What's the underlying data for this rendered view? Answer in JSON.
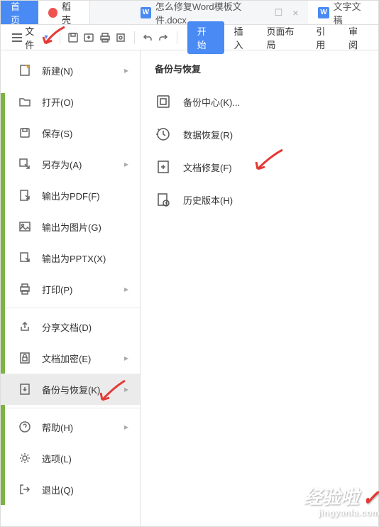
{
  "tabs": {
    "home": "首页",
    "docker": "稻壳",
    "doc1": "怎么修复Word模板文件.docx",
    "doc2": "文字文稿"
  },
  "toolbar": {
    "file": "文件",
    "start": "开始",
    "insert": "插入",
    "pageLayout": "页面布局",
    "reference": "引用",
    "review": "审阅"
  },
  "menu": {
    "new": "新建(N)",
    "open": "打开(O)",
    "save": "保存(S)",
    "saveAs": "另存为(A)",
    "exportPdf": "输出为PDF(F)",
    "exportImage": "输出为图片(G)",
    "exportPptx": "输出为PPTX(X)",
    "print": "打印(P)",
    "share": "分享文档(D)",
    "encrypt": "文档加密(E)",
    "backup": "备份与恢复(K)",
    "help": "帮助(H)",
    "options": "选项(L)",
    "exit": "退出(Q)"
  },
  "submenu": {
    "title": "备份与恢复",
    "backupCenter": "备份中心(K)...",
    "dataRecover": "数据恢复(R)",
    "docRepair": "文档修复(F)",
    "history": "历史版本(H)"
  },
  "watermark": {
    "main": "经验啦",
    "sub": "jingyanla.com"
  }
}
